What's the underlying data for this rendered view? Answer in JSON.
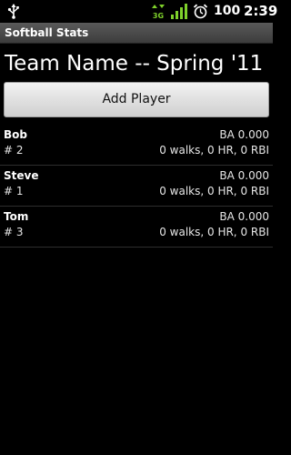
{
  "status_bar": {
    "network_label": "3G",
    "battery": "100",
    "time": "2:39",
    "icons": [
      "usb-icon",
      "3g-icon",
      "signal-icon",
      "alarm-icon"
    ]
  },
  "app": {
    "title": "Softball Stats"
  },
  "team": {
    "name": "Team Name -- Spring '11"
  },
  "actions": {
    "add_player_label": "Add Player"
  },
  "players": [
    {
      "name": "Bob",
      "number": "# 2",
      "ba": "BA 0.000",
      "stats": "0 walks, 0 HR, 0 RBI"
    },
    {
      "name": "Steve",
      "number": "# 1",
      "ba": "BA 0.000",
      "stats": "0 walks, 0 HR, 0 RBI"
    },
    {
      "name": "Tom",
      "number": "# 3",
      "ba": "BA 0.000",
      "stats": "0 walks, 0 HR, 0 RBI"
    }
  ],
  "colors": {
    "background": "#000000",
    "title_bar": "#4a4a4a",
    "button": "#e0e0e0",
    "divider": "#2e2e2e"
  }
}
